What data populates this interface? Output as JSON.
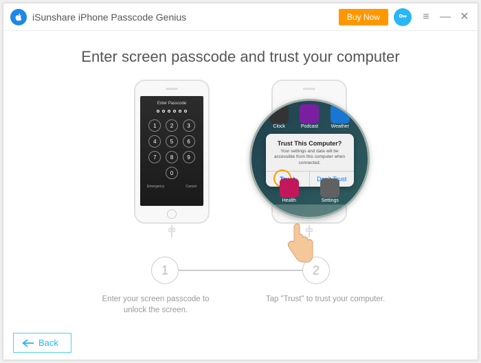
{
  "window": {
    "app_title": "iSunshare iPhone Passcode Genius",
    "buy_label": "Buy Now"
  },
  "page": {
    "main_title": "Enter screen passcode and trust your computer",
    "step_1_num": "1",
    "step_2_num": "2",
    "step_1_text": "Enter your screen passcode to unlock the screen.",
    "step_2_text": "Tap \"Trust\" to trust your computer.",
    "back_label": "Back"
  },
  "phone1": {
    "enter_passcode_label": "Enter Passcode",
    "keypad": [
      "1",
      "2",
      "3",
      "4",
      "5",
      "6",
      "7",
      "8",
      "9",
      "0"
    ],
    "emergency_label": "Emergency",
    "cancel_label": "Cancel"
  },
  "phone2": {
    "alert_title": "Trust This Computer?",
    "alert_msg": "Your settings and data will be accessible from this computer when connected.",
    "trust_label": "Trust",
    "dont_trust_label": "Don't Trust",
    "mag_labels": {
      "clock": "Clock",
      "podcast": "Podcast",
      "weather": "Weather",
      "health": "Health",
      "settings": "Settings"
    }
  }
}
